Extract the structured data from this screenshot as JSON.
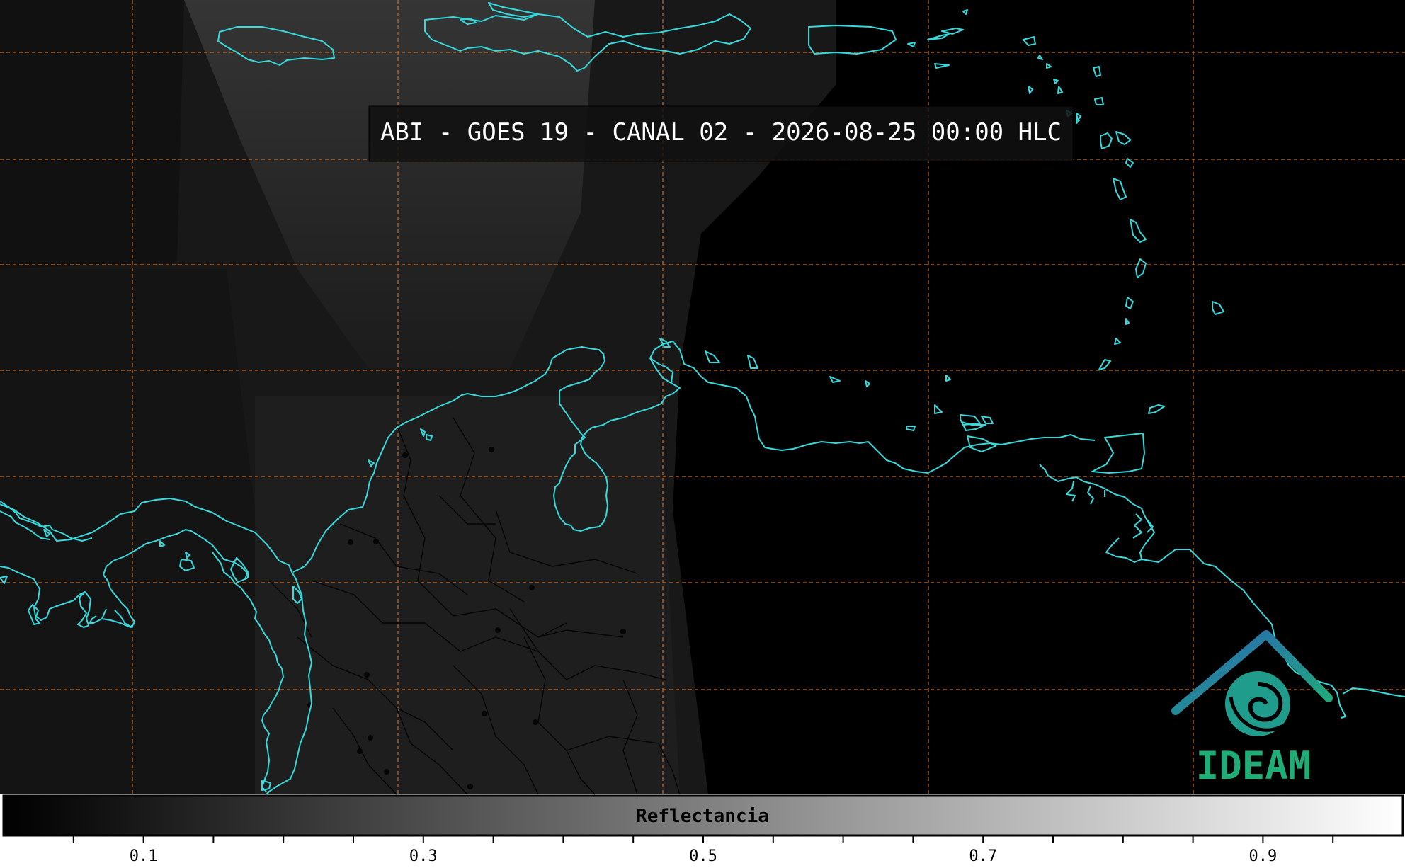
{
  "title": "ABI - GOES 19 - CANAL 02 - 2026-08-25 00:00 HLC",
  "colorbar": {
    "label": "Reflectancia",
    "range": [
      0,
      1
    ],
    "tick_labels": [
      "0.1",
      "0.3",
      "0.5",
      "0.7",
      "0.9"
    ],
    "tick_values": [
      0.1,
      0.3,
      0.5,
      0.7,
      0.9
    ],
    "minor_tick_step": 0.05
  },
  "logo": {
    "text": "IDEAM"
  },
  "colors": {
    "background": "#000000",
    "coastline": "#36d9dc",
    "gridline": "#c8691e",
    "borders": "#0a0a0a",
    "logo_blue": "#2a78b6",
    "logo_green": "#1fae78",
    "title_text": "#ffffff"
  }
}
